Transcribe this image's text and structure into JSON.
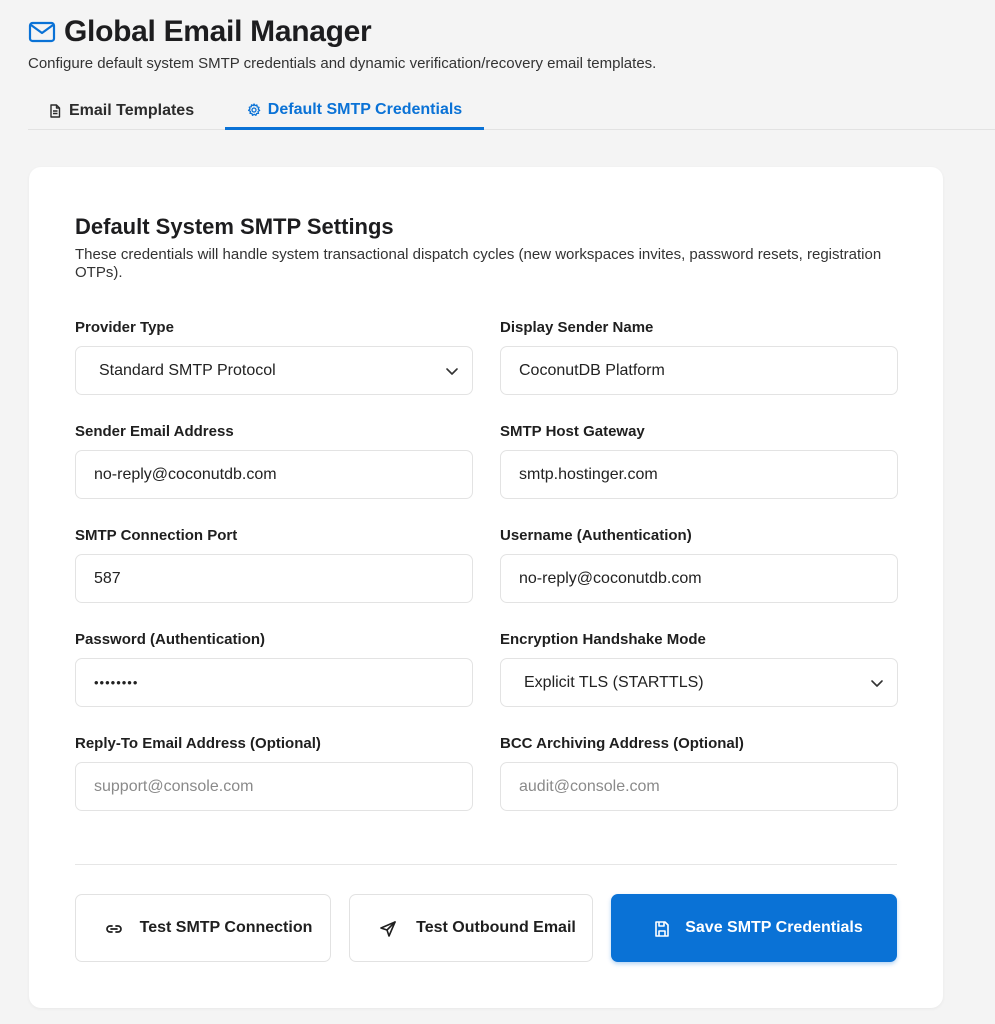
{
  "header": {
    "title": "Global Email Manager",
    "subtitle": "Configure default system SMTP credentials and dynamic verification/recovery email templates."
  },
  "tabs": [
    {
      "label": "Email Templates",
      "icon": "document-icon",
      "active": false
    },
    {
      "label": "Default SMTP Credentials",
      "icon": "gear-icon",
      "active": true
    }
  ],
  "card": {
    "title": "Default System SMTP Settings",
    "description": "These credentials will handle system transactional dispatch cycles (new workspaces invites, password resets, registration OTPs)."
  },
  "fields": {
    "provider_type": {
      "label": "Provider Type",
      "value": "Standard SMTP Protocol"
    },
    "display_sender_name": {
      "label": "Display Sender Name",
      "value": "CoconutDB Platform"
    },
    "sender_email": {
      "label": "Sender Email Address",
      "value": "no-reply@coconutdb.com"
    },
    "smtp_host": {
      "label": "SMTP Host Gateway",
      "value": "smtp.hostinger.com"
    },
    "smtp_port": {
      "label": "SMTP Connection Port",
      "value": "587"
    },
    "username": {
      "label": "Username (Authentication)",
      "value": "no-reply@coconutdb.com"
    },
    "password": {
      "label": "Password (Authentication)",
      "value": "••••••••"
    },
    "encryption": {
      "label": "Encryption Handshake Mode",
      "value": "Explicit TLS (STARTTLS)"
    },
    "reply_to": {
      "label": "Reply-To Email Address (Optional)",
      "placeholder": "support@console.com"
    },
    "bcc": {
      "label": "BCC Archiving Address (Optional)",
      "placeholder": "audit@console.com"
    }
  },
  "actions": {
    "test_connection": "Test SMTP Connection",
    "test_email": "Test Outbound Email",
    "save": "Save SMTP Credentials"
  },
  "colors": {
    "accent": "#0a72d6",
    "background": "#f4f4f4"
  }
}
